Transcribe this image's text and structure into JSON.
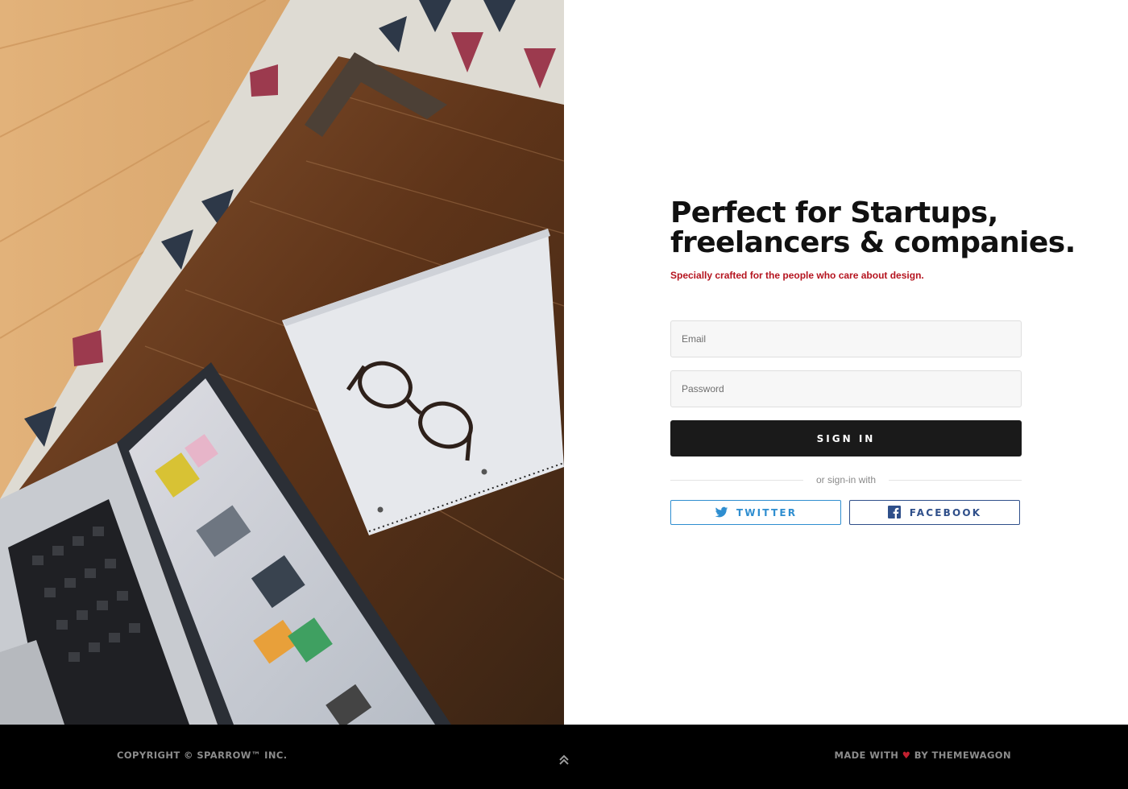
{
  "hero": {
    "image": "laptop-notebook-glasses-on-desk-photo"
  },
  "auth": {
    "headline_line1": "Perfect for Startups,",
    "headline_line2": "freelancers & companies.",
    "subtitle": "Specially crafted for the people who care about design.",
    "email_placeholder": "Email",
    "password_placeholder": "Password",
    "signin_label": "SIGN IN",
    "divider_text": "or sign-in with",
    "social": {
      "twitter_label": "TWITTER",
      "facebook_label": "FACEBOOK"
    }
  },
  "footer": {
    "copyright": "COPYRIGHT © SPARROW™ INC.",
    "made_with": "MADE WITH",
    "heart": "♥",
    "by": "BY THEMEWAGON"
  },
  "colors": {
    "accent_red": "#b5141f",
    "twitter_blue": "#2f8ed0",
    "facebook_blue": "#2f4f8a",
    "button_dark": "#1a1a1a",
    "footer_bg": "#000000"
  },
  "icons": [
    "twitter-icon",
    "facebook-icon",
    "chevron-double-up-icon",
    "heart-icon"
  ]
}
